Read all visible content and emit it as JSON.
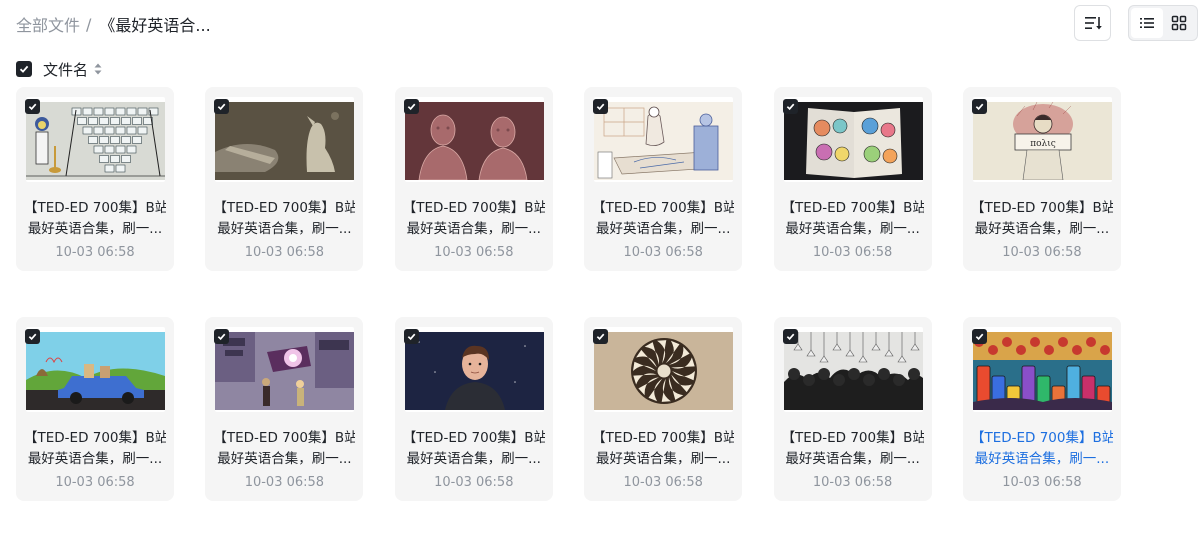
{
  "breadcrumb": {
    "root": "全部文件",
    "separator": "/",
    "current": "《最好英语合..."
  },
  "toolbar": {
    "sort_icon": "sort-icon",
    "list_icon": "list-view-icon",
    "grid_icon": "grid-view-icon"
  },
  "list_header": {
    "column_label": "文件名"
  },
  "colors": {
    "checkbox": "#1f2329",
    "selected_text": "#1d6fe0",
    "card_bg": "#f5f5f5",
    "muted": "#8f959e"
  },
  "files": [
    {
      "title_line1": "【TED-ED 700集】B站",
      "title_line2": "最好英语合集，刷一...",
      "date": "10-03 06:58",
      "thumb": "grey-lab-pyramid"
    },
    {
      "title_line1": "【TED-ED 700集】B站",
      "title_line2": "最好英语合集，刷一...",
      "date": "10-03 06:58",
      "thumb": "brown-cave-hound"
    },
    {
      "title_line1": "【TED-ED 700集】B站",
      "title_line2": "最好英语合集，刷一...",
      "date": "10-03 06:58",
      "thumb": "red-twin-busts"
    },
    {
      "title_line1": "【TED-ED 700集】B站",
      "title_line2": "最好英语合集，刷一...",
      "date": "10-03 06:58",
      "thumb": "sketch-blueprint-people"
    },
    {
      "title_line1": "【TED-ED 700集】B站",
      "title_line2": "最好英语合集，刷一...",
      "date": "10-03 06:58",
      "thumb": "dark-book-faces"
    },
    {
      "title_line1": "【TED-ED 700集】B站",
      "title_line2": "最好英语合集，刷一...",
      "date": "10-03 06:58",
      "thumb": "beige-sign-figure"
    },
    {
      "title_line1": "【TED-ED 700集】B站",
      "title_line2": "最好英语合集，刷一...",
      "date": "10-03 06:58",
      "thumb": "blue-car-hills"
    },
    {
      "title_line1": "【TED-ED 700集】B站",
      "title_line2": "最好英语合集，刷一...",
      "date": "10-03 06:58",
      "thumb": "purple-neon-city"
    },
    {
      "title_line1": "【TED-ED 700集】B站",
      "title_line2": "最好英语合集，刷一...",
      "date": "10-03 06:58",
      "thumb": "night-portrait-boy"
    },
    {
      "title_line1": "【TED-ED 700集】B站",
      "title_line2": "最好英语合集，刷一...",
      "date": "10-03 06:58",
      "thumb": "tan-spiral-wheel"
    },
    {
      "title_line1": "【TED-ED 700集】B站",
      "title_line2": "最好英语合集，刷一...",
      "date": "10-03 06:58",
      "thumb": "bw-crowd-lamps"
    },
    {
      "title_line1": "【TED-ED 700集】B站",
      "title_line2": "最好英语合集，刷一...",
      "date": "10-03 06:58",
      "thumb": "colorful-cans-crowd",
      "selected": true
    }
  ]
}
